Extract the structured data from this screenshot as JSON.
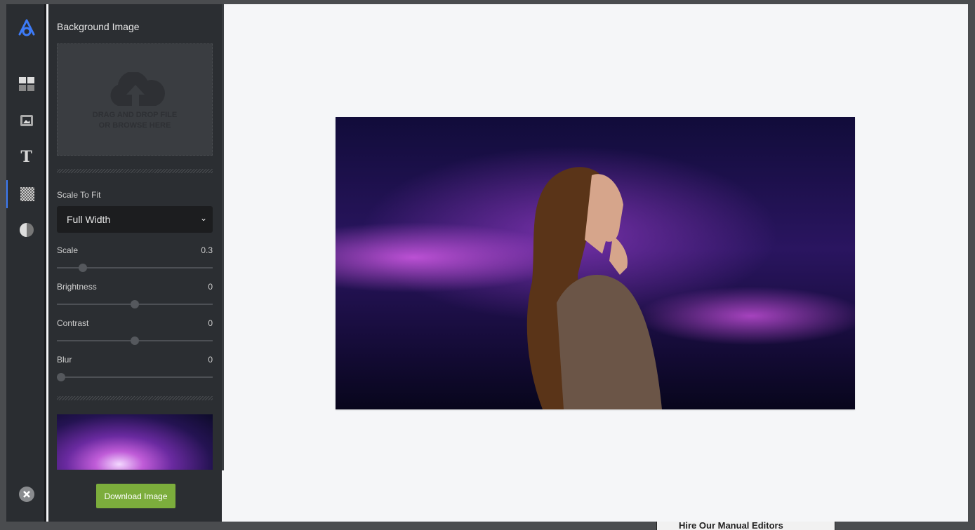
{
  "background": {
    "behind_text": "Hire Our Manual Editors"
  },
  "rail": {
    "items": [
      {
        "icon": "logo-icon"
      },
      {
        "icon": "layout-grid-icon"
      },
      {
        "icon": "image-icon"
      },
      {
        "icon": "text-icon"
      },
      {
        "icon": "background-pattern-icon",
        "active": true
      },
      {
        "icon": "contrast-icon"
      }
    ],
    "close_icon": "close-icon",
    "accent": "#3d7bf7"
  },
  "panel": {
    "title": "Background Image",
    "dropzone": {
      "line1": "DRAG AND DROP FILE",
      "line2": "OR BROWSE HERE"
    },
    "scale_to_fit": {
      "label": "Scale To Fit",
      "value": "Full Width"
    },
    "sliders": [
      {
        "label": "Scale",
        "value": "0.3"
      },
      {
        "label": "Brightness",
        "value": "0"
      },
      {
        "label": "Contrast",
        "value": "0"
      },
      {
        "label": "Blur",
        "value": "0"
      }
    ],
    "download_label": "Download Image",
    "download_color": "#7cad3c"
  }
}
